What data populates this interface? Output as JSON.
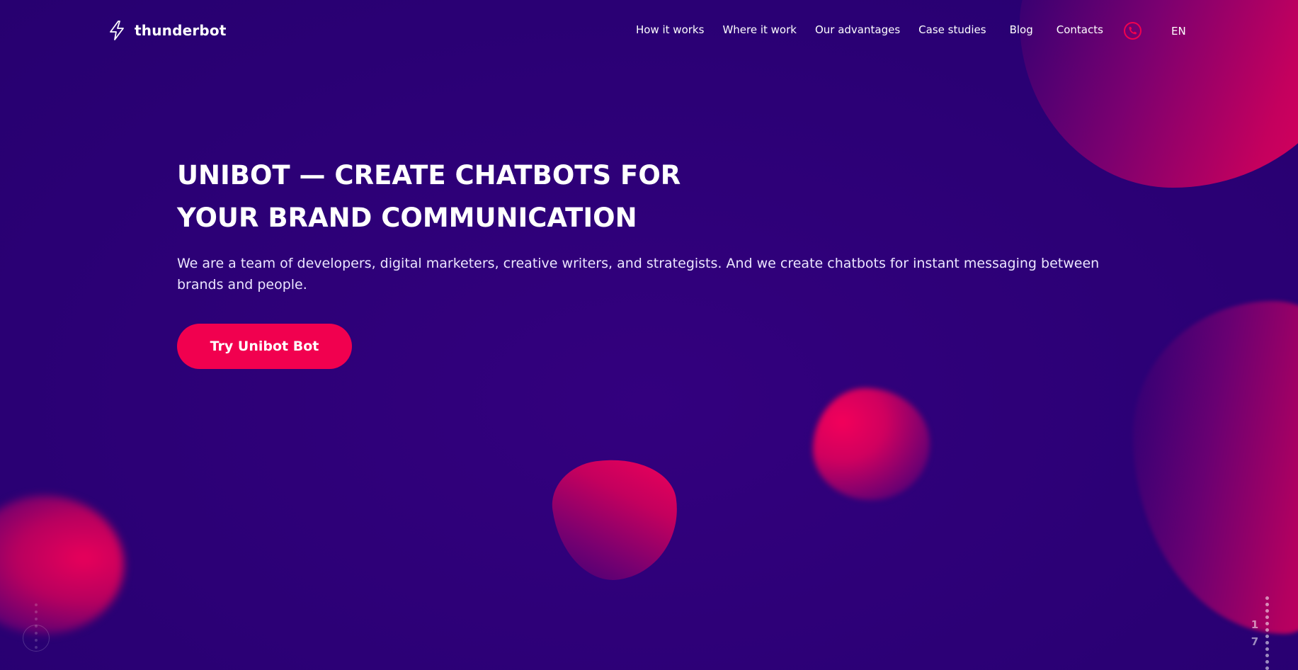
{
  "brand": {
    "name": "thunderbot",
    "logo_icon": "lightning-bolt-icon"
  },
  "nav": {
    "items": [
      {
        "label": "How it works"
      },
      {
        "label": "Where it work"
      },
      {
        "label": "Our advantages"
      },
      {
        "label": "Case studies"
      },
      {
        "label": "Blog"
      },
      {
        "label": "Contacts"
      }
    ],
    "phone_icon": "phone-icon",
    "language": "EN"
  },
  "hero": {
    "title_line1": "UNIBOT — CREATE CHATBOTS FOR",
    "title_line2": "YOUR BRAND COMMUNICATION",
    "description": "We are a team of developers, digital marketers, creative writers, and strategists. And we create chatbots for instant messaging between brands and people.",
    "cta_label": "Try Unibot Bot"
  },
  "pager": {
    "current": "1",
    "total": "7"
  },
  "colors": {
    "background": "#2d0078",
    "accent": "#f1004f",
    "text": "#ffffff"
  }
}
